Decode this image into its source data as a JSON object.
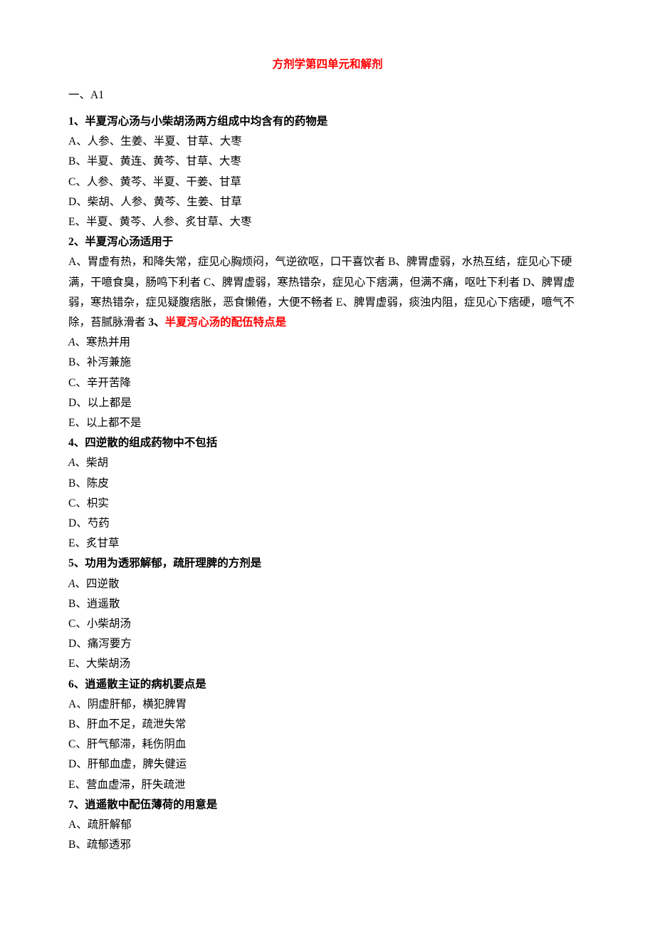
{
  "title": "方剂学第四单元和解剂",
  "section": "一、A1",
  "q1": {
    "num": "1",
    "sep": "、",
    "text": "半夏泻心汤与小柴胡汤两方组成中均含有的药物是",
    "opts": {
      "A": "A、人参、生姜、半夏、甘草、大枣",
      "B": "B、半夏、黄连、黄芩、甘草、大枣",
      "C": "C、人参、黄芩、半夏、干姜、甘草",
      "D": "D、柴胡、人参、黄芩、生姜、甘草",
      "E": "E、半夏、黄芩、人参、炙甘草、大枣"
    }
  },
  "q2": {
    "num": "2",
    "sep": "、",
    "text": "半夏泻心汤适用于",
    "body_pre": "A、胃虚有热，和降失常，症见心胸烦闷，气逆欲呕，口干喜饮者 B、脾胃虚弱，水热互结，症见心下硬满，干噫食臭，肠鸣下利者 C、脾胃虚弱，寒热错杂，症见心下痞满，但满不痛，呕吐下利者 D、脾胃虚弱，寒热错杂，症见疑腹痞胀，恶食懒倦，大便不畅者 E、脾胃虚弱，痰浊内阻，症见心下痞硬，噫气不除，苔腻脉滑者 ",
    "q3num": "3",
    "q3sep": "、",
    "q3text_red": "半夏泻心汤的配伍特点是"
  },
  "q3": {
    "opts": {
      "A_letter": "A",
      "A_rest": "、寒热并用",
      "B": "B、补泻兼施",
      "C": "C、辛开苦降",
      "D": "D、以上都是",
      "E": "E、以上都不是"
    }
  },
  "q4": {
    "num": "4",
    "sep": "、",
    "text": "四逆散的组成药物中不包括",
    "opts": {
      "A_letter": "A",
      "A_rest": "、柴胡",
      "B": "B、陈皮",
      "C": "C、枳实",
      "D": "D、芍药",
      "E": "E、炙甘草"
    }
  },
  "q5": {
    "num": "5",
    "sep": "、",
    "text": "功用为透邪解郁，疏肝理脾的方剂是",
    "opts": {
      "A_letter": "A",
      "A_rest": "、四逆散",
      "B": "B、逍遥散",
      "C": "C、小柴胡汤",
      "D": "D、痛泻要方",
      "E": "E、大柴胡汤"
    }
  },
  "q6": {
    "num": "6",
    "sep": "、",
    "text": "逍遥散主证的病机要点是",
    "opts": {
      "A": "A、阴虚肝郁，横犯脾胃",
      "B": "B、肝血不足，疏泄失常",
      "C": "C、肝气郁滞，耗伤阴血",
      "D": "D、肝郁血虚，脾失健运",
      "E": "E、营血虚滞，肝失疏泄"
    }
  },
  "q7": {
    "num": "7",
    "sep": "、",
    "text": "逍遥散中配伍薄荷的用意是",
    "opts": {
      "A": "A、疏肝解郁",
      "B": "B、疏郁透邪"
    }
  }
}
